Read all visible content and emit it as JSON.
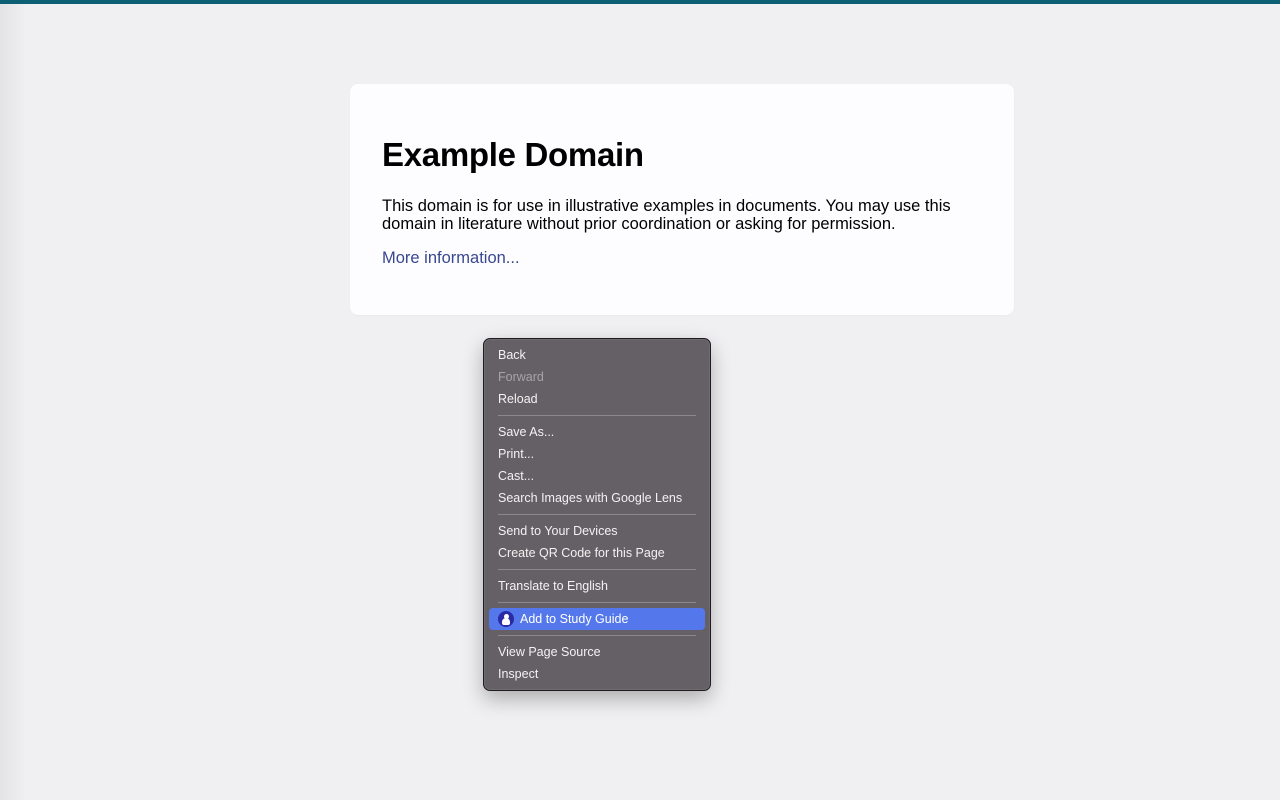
{
  "page": {
    "title": "Example Domain",
    "description": "This domain is for use in illustrative examples in documents. You may use this domain in literature without prior coordination or asking for permission.",
    "link_label": "More information..."
  },
  "context_menu": {
    "items": [
      {
        "label": "Back",
        "enabled": true
      },
      {
        "label": "Forward",
        "enabled": false
      },
      {
        "label": "Reload",
        "enabled": true
      },
      {
        "label": "Save As...",
        "enabled": true
      },
      {
        "label": "Print...",
        "enabled": true
      },
      {
        "label": "Cast...",
        "enabled": true
      },
      {
        "label": "Search Images with Google Lens",
        "enabled": true
      },
      {
        "label": "Send to Your Devices",
        "enabled": true
      },
      {
        "label": "Create QR Code for this Page",
        "enabled": true
      },
      {
        "label": "Translate to English",
        "enabled": true
      },
      {
        "label": "Add to Study Guide",
        "enabled": true,
        "highlighted": true,
        "icon": "study-guide-extension-icon"
      },
      {
        "label": "View Page Source",
        "enabled": true
      },
      {
        "label": "Inspect",
        "enabled": true
      }
    ]
  },
  "colors": {
    "accent_bar": "#0d5f73",
    "link": "#38488f",
    "menu_background": "#656065",
    "menu_highlight": "#5478ec"
  }
}
